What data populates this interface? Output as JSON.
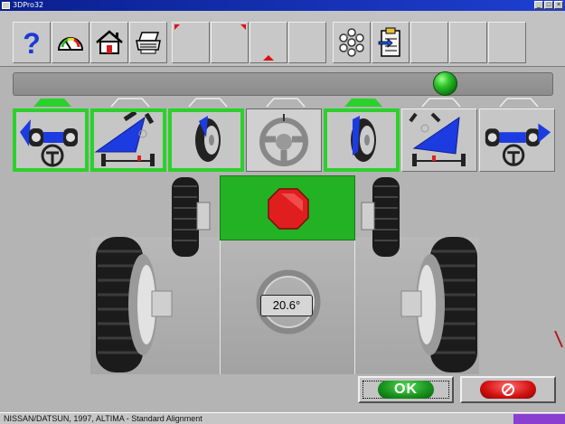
{
  "window": {
    "title": "3DPro32"
  },
  "toolbar": {
    "buttons": [
      {
        "name": "help",
        "icon": "question-mark-icon"
      },
      {
        "name": "gauge",
        "icon": "gauge-icon"
      },
      {
        "name": "home",
        "icon": "home-icon"
      },
      {
        "name": "print",
        "icon": "printer-icon"
      },
      {
        "name": "blank-1",
        "icon": "red-corner-icon"
      },
      {
        "name": "blank-2",
        "icon": "red-corner-icon"
      },
      {
        "name": "blank-3",
        "icon": "red-arrows-icon"
      },
      {
        "name": "blank-4",
        "icon": ""
      },
      {
        "name": "settings",
        "icon": "molecule-icon"
      },
      {
        "name": "clipboard",
        "icon": "clipboard-arrow-icon"
      },
      {
        "name": "blank-5",
        "icon": ""
      },
      {
        "name": "blank-6",
        "icon": ""
      },
      {
        "name": "blank-7",
        "icon": ""
      }
    ]
  },
  "status_indicator": {
    "state": "ready",
    "color": "#2ec42a"
  },
  "steps": [
    {
      "name": "rear-axle",
      "state": "done"
    },
    {
      "name": "thrust-angle",
      "state": "done"
    },
    {
      "name": "right-wheel-turn",
      "state": "done"
    },
    {
      "name": "steering-wheel",
      "state": "current"
    },
    {
      "name": "left-wheel-turn",
      "state": "done"
    },
    {
      "name": "caster-sweep",
      "state": "pending"
    },
    {
      "name": "front-axle",
      "state": "pending"
    }
  ],
  "scene": {
    "stop_icon": "stop-sign-icon",
    "steer_angle": "20.6°"
  },
  "buttons": {
    "ok_label": "OK",
    "cancel_icon": "no-entry-icon"
  },
  "status_bar": {
    "vehicle": "NISSAN/DATSUN, 1997, ALTIMA - Standard Alignment"
  },
  "colors": {
    "accent_green": "#2bd12b",
    "stop_red": "#e01e1e",
    "step_blue": "#1c3be0"
  }
}
